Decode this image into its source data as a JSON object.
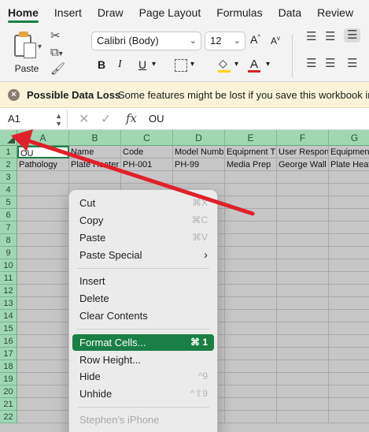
{
  "tabs": [
    "Home",
    "Insert",
    "Draw",
    "Page Layout",
    "Formulas",
    "Data",
    "Review"
  ],
  "ribbon": {
    "paste_label": "Paste",
    "font_name": "Calibri (Body)",
    "font_size": "12",
    "bold": "B",
    "italic": "I",
    "underline": "U",
    "grow_font": "A",
    "shrink_font": "A",
    "fill_color": "#ffd600",
    "font_color": "#e0202a"
  },
  "warning": {
    "icon": "close-circle-icon",
    "title": "Possible Data Loss",
    "message": "Some features might be lost if you save this workbook in"
  },
  "formula_bar": {
    "cell_ref": "A1",
    "fx": "fx",
    "value": "OU"
  },
  "grid": {
    "columns": [
      "A",
      "B",
      "C",
      "D",
      "E",
      "F",
      "G"
    ],
    "rows": [
      "1",
      "2",
      "3",
      "4",
      "5",
      "6",
      "7",
      "8",
      "9",
      "10",
      "11",
      "12",
      "13",
      "14",
      "15",
      "16",
      "17",
      "18",
      "19",
      "20",
      "21",
      "22"
    ],
    "row1": [
      "OU",
      "Name",
      "Code",
      "Model Numb",
      "Equipment T",
      "User Respon",
      "Equipment"
    ],
    "row2": [
      "Pathology",
      "Plate Heater",
      "PH-001",
      "PH-99",
      "Media Prep",
      "George Wall",
      "Plate Heate"
    ],
    "accent": "#1a7f44"
  },
  "menu": {
    "items": [
      {
        "label": "Cut",
        "shortcut": "⌘X"
      },
      {
        "label": "Copy",
        "shortcut": "⌘C"
      },
      {
        "label": "Paste",
        "shortcut": "⌘V"
      },
      {
        "label": "Paste Special",
        "shortcut": "›"
      },
      {
        "label": "Insert",
        "shortcut": ""
      },
      {
        "label": "Delete",
        "shortcut": ""
      },
      {
        "label": "Clear Contents",
        "shortcut": ""
      },
      {
        "label": "Format Cells...",
        "shortcut": "⌘ 1"
      },
      {
        "label": "Row Height...",
        "shortcut": ""
      },
      {
        "label": "Hide",
        "shortcut": "^9"
      },
      {
        "label": "Unhide",
        "shortcut": "^⇧9"
      },
      {
        "label": "Stephen's iPhone",
        "shortcut": ""
      }
    ]
  },
  "annotation_color": "#e0202a"
}
